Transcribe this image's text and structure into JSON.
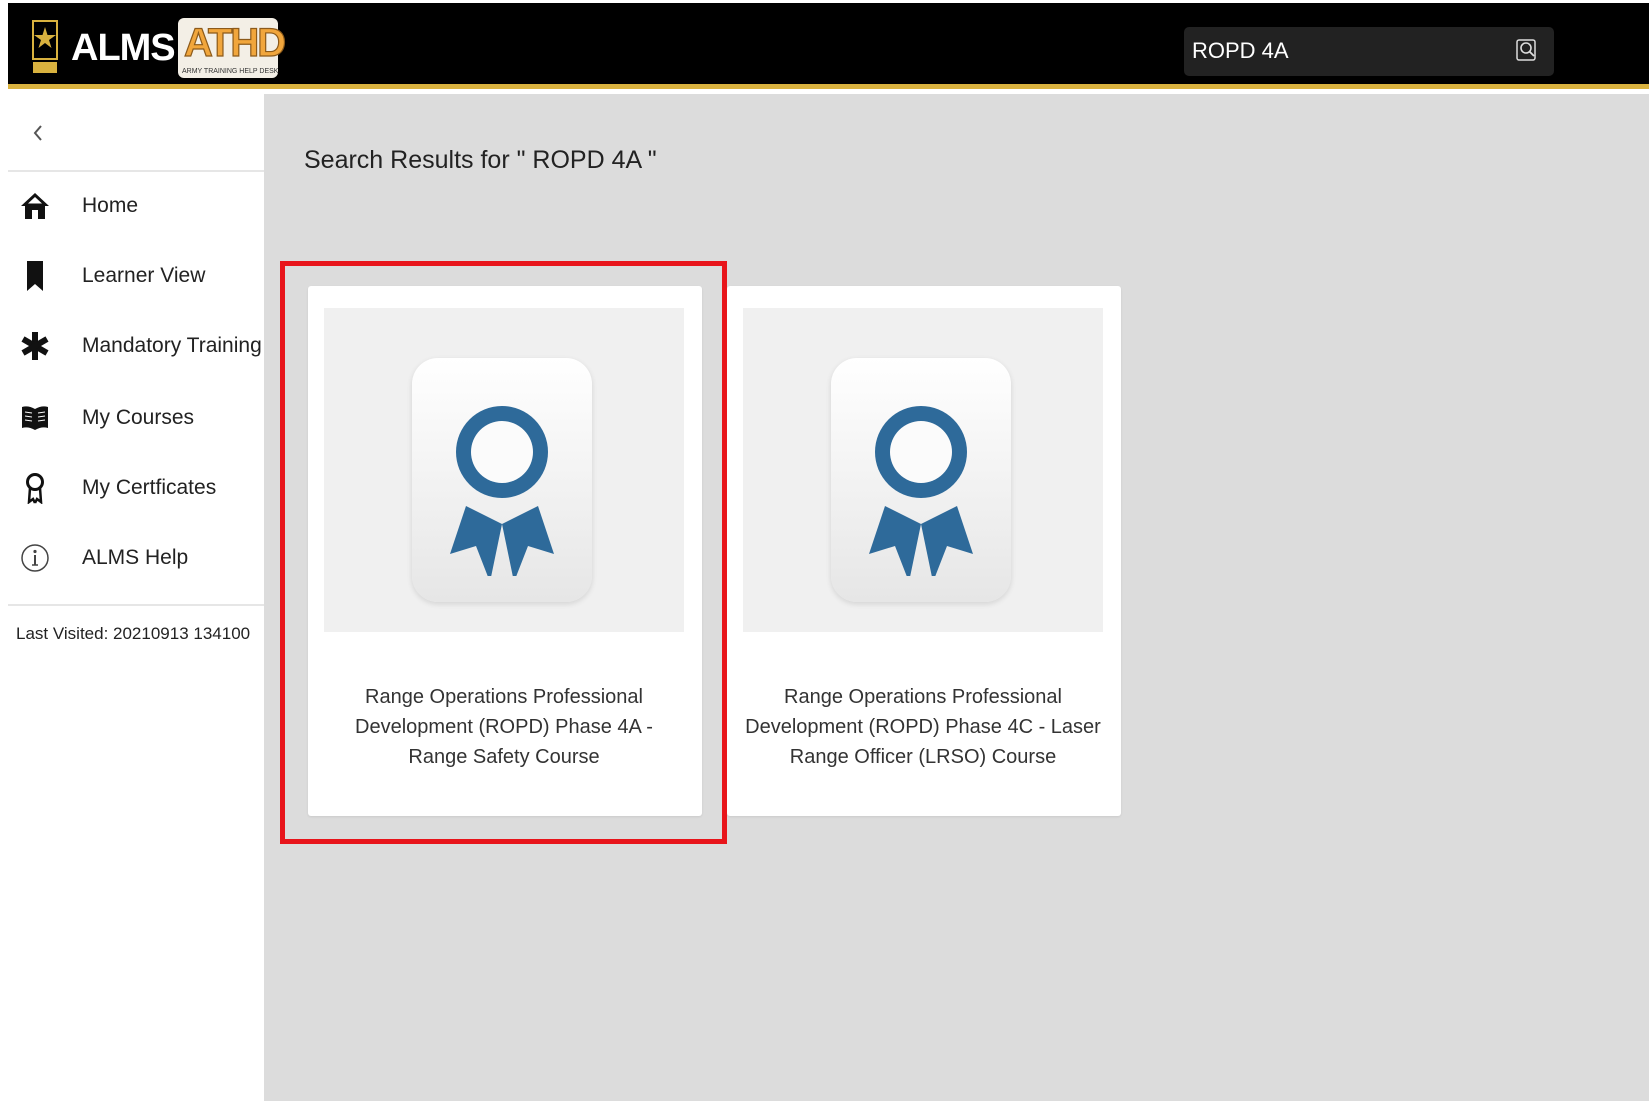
{
  "header": {
    "brand": "ALMS",
    "help_desk_logo": "ATHD",
    "help_desk_caption": "ARMY TRAINING HELP DESK",
    "army_logo": "U.S. ARMY",
    "search_value": "ROPD 4A",
    "search_icon": "search-icon"
  },
  "sidebar": {
    "collapse_icon": "chevron-left-icon",
    "items": [
      {
        "label": "Home",
        "icon": "home-icon"
      },
      {
        "label": "Learner View",
        "icon": "bookmark-icon"
      },
      {
        "label": "Mandatory Training",
        "icon": "asterisk-icon"
      },
      {
        "label": "My Courses",
        "icon": "book-icon"
      },
      {
        "label": "My Certficates",
        "icon": "ribbon-icon"
      },
      {
        "label": "ALMS Help",
        "icon": "info-icon"
      }
    ],
    "last_visited": "Last Visited: 20210913 134100"
  },
  "main": {
    "results_title": "Search Results for \" ROPD 4A \"",
    "results": [
      {
        "title": "Range Operations Professional Development (ROPD) Phase 4A - Range Safety Course",
        "icon": "award-ribbon-icon",
        "highlighted": true
      },
      {
        "title": "Range Operations Professional Development (ROPD) Phase 4C - Laser Range Officer (LRSO) Course",
        "icon": "award-ribbon-icon",
        "highlighted": false
      }
    ]
  },
  "colors": {
    "header_bg": "#000000",
    "header_accent": "#d9b23f",
    "main_bg": "#dcdcdc",
    "badge_blue": "#2e6a9a",
    "highlight": "#e8151b"
  }
}
